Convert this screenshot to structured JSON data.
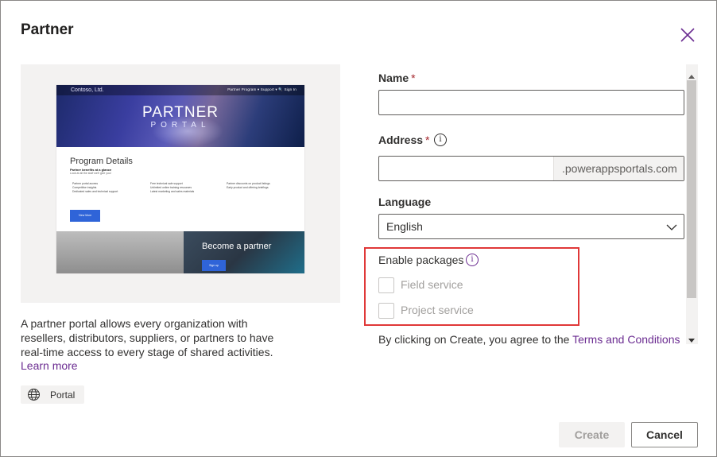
{
  "dialog": {
    "title": "Partner",
    "close_icon": "close-icon"
  },
  "preview": {
    "thumb_brand": "Contoso, Ltd.",
    "thumb_nav": "Partner Program ▾   Support ▾   🔍   Sign In",
    "hero_title": "PARTNER",
    "hero_sub": "PORTAL",
    "program_title": "Program Details",
    "program_sub": "Partner benefits at a glance",
    "program_sub2": "Look at all the stuff we'll give you!",
    "bullets_col1": [
      "Partner portal access",
      "Competitive insights",
      "Dedicated sales and technical support"
    ],
    "bullets_col2": [
      "Free technical sale support",
      "Unlimited online training resources",
      "Latest marketing and sales materials"
    ],
    "bullets_col3": [
      "Partner discounts on product listings",
      "Early product and offering briefings"
    ],
    "view_more": "View More",
    "become_partner": "Become a partner",
    "signup": "Sign up"
  },
  "description": {
    "text": "A partner portal allows every organization with resellers, distributors, suppliers, or partners to have real-time access to every stage of shared activities.",
    "learn_more": "Learn more"
  },
  "tag": {
    "icon": "globe-icon",
    "label": "Portal"
  },
  "form": {
    "name_label": "Name",
    "required_mark": "*",
    "name_value": "",
    "address_label": "Address",
    "address_value": "",
    "address_suffix": ".powerappsportals.com",
    "language_label": "Language",
    "language_value": "English",
    "packages_label": "Enable packages",
    "packages": [
      {
        "label": "Field service",
        "checked": false
      },
      {
        "label": "Project service",
        "checked": false
      }
    ],
    "terms_text": "By clicking on Create, you agree to the",
    "terms_link": "Terms and Conditions"
  },
  "footer": {
    "create_label": "Create",
    "cancel_label": "Cancel"
  },
  "colors": {
    "accent": "#6b2c91",
    "highlight": "#e03838",
    "required": "#a4262c"
  }
}
